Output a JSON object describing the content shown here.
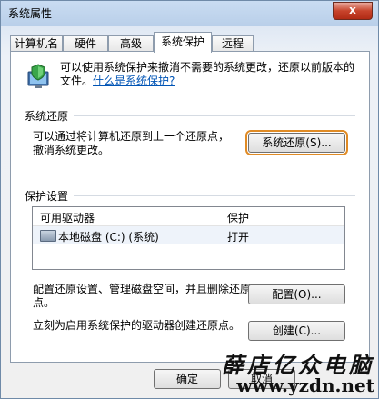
{
  "window": {
    "title": "系统属性",
    "close": "x"
  },
  "tabs": [
    {
      "label": "计算机名",
      "active": false
    },
    {
      "label": "硬件",
      "active": false
    },
    {
      "label": "高级",
      "active": false
    },
    {
      "label": "系统保护",
      "active": true
    },
    {
      "label": "远程",
      "active": false
    }
  ],
  "intro": {
    "text": "可以使用系统保护来撤消不需要的系统更改，还原以前版本的文件。",
    "link": "什么是系统保护?"
  },
  "restore": {
    "section": "系统还原",
    "description": "可以通过将计算机还原到上一个还原点，撤消系统更改。",
    "button": "系统还原(S)..."
  },
  "protection": {
    "section": "保护设置",
    "columns": [
      "可用驱动器",
      "保护"
    ],
    "rows": [
      {
        "drive": "本地磁盘 (C:) (系统)",
        "status": "打开"
      }
    ],
    "configure_text": "配置还原设置、管理磁盘空间，并且删除还原点。",
    "configure_button": "配置(O)...",
    "create_text": "立刻为启用系统保护的驱动器创建还原点。",
    "create_button": "创建(C)..."
  },
  "footer": {
    "ok": "确定",
    "cancel": "取消"
  },
  "watermark": {
    "title": "薛店亿众电脑",
    "url": "www.yzdn.net"
  }
}
